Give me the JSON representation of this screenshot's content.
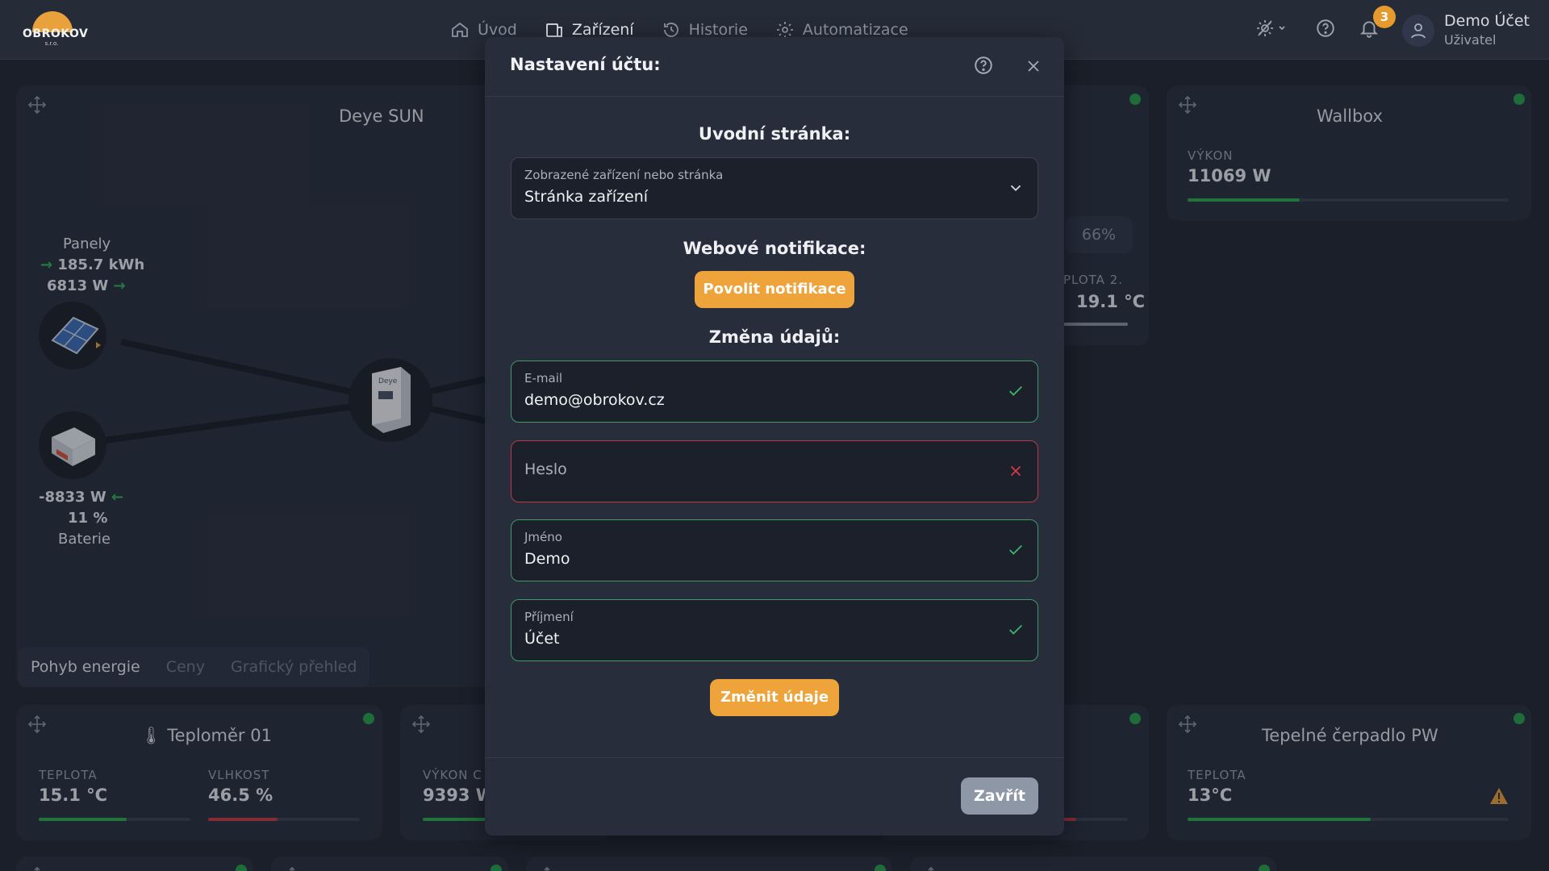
{
  "logo": {
    "name": "OBROKOV",
    "suffix": "s.r.o."
  },
  "nav": [
    {
      "label": "Úvod",
      "icon": "home-icon"
    },
    {
      "label": "Zařízení",
      "icon": "device-icon",
      "active": true
    },
    {
      "label": "Historie",
      "icon": "history-icon"
    },
    {
      "label": "Automatizace",
      "icon": "automation-gear-icon"
    }
  ],
  "user": {
    "notifications": "3",
    "name": "Demo Účet",
    "role": "Uživatel"
  },
  "deye": {
    "title": "Deye SUN",
    "panels_label": "Panely",
    "panels_energy": "185.7 kWh",
    "panels_power": "6813 W",
    "battery_power": "-8833 W",
    "battery_percent": "11 %",
    "battery_label": "Baterie",
    "tabs": [
      "Pohyb energie",
      "Ceny",
      "Grafický přehled"
    ]
  },
  "middle_card": {
    "percent": "66%",
    "temp_label": "PLOTA 2.",
    "temp_value": "19.1 °C"
  },
  "wallbox": {
    "title": "Wallbox",
    "label": "VÝKON",
    "value": "11069 W",
    "fill": 0.35
  },
  "thermometer": {
    "title": "Teploměr 01",
    "temp_label": "TEPLOTA",
    "temp_value": "15.1 °C",
    "temp_fill": 0.58,
    "hum_label": "VLHKOST",
    "hum_value": "46.5 %",
    "hum_fill": 0.46
  },
  "power_card": {
    "label": "VÝKON C",
    "value": "9393 W"
  },
  "heatpump": {
    "title": "Tepelné čerpadlo PW",
    "label": "TEPLOTA",
    "value": "13°C",
    "fill": 0.57
  },
  "modal": {
    "title": "Nastavení účtu:",
    "homepage_heading": "Uvodní stránka:",
    "homepage_select": {
      "label": "Zobrazené zařízení nebo stránka",
      "value": "Stránka zařízení"
    },
    "web_heading": "Webové notifikace:",
    "enable_button": "Povolit notifikace",
    "change_heading": "Změna údajů:",
    "email": {
      "label": "E-mail",
      "value": "demo@obrokov.cz"
    },
    "password": {
      "placeholder": "Heslo"
    },
    "first_name": {
      "label": "Jméno",
      "value": "Demo"
    },
    "last_name": {
      "label": "Příjmení",
      "value": "Účet"
    },
    "change_button": "Změnit údaje",
    "close_button": "Zavřít"
  },
  "colors": {
    "accent": "#eea33b",
    "ok": "#3f9b68",
    "error": "#d23a44",
    "status": "#29a04a",
    "bar_green": "#2fa851",
    "bar_red": "#c53b44"
  }
}
